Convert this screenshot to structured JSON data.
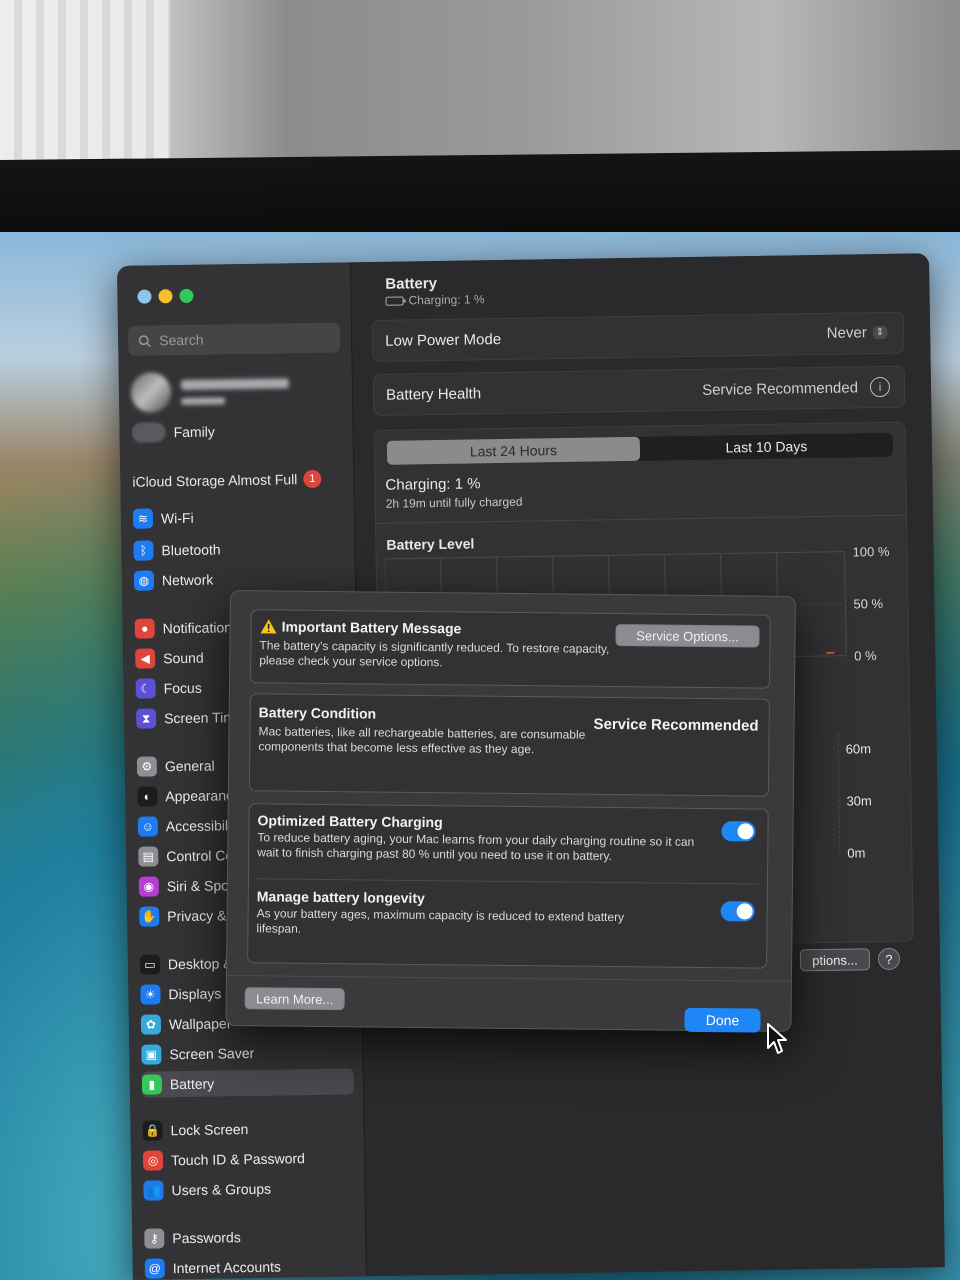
{
  "colors": {
    "accent": "#1f86f5",
    "badge": "#e0453b",
    "warning": "#f5c518"
  },
  "sidebar": {
    "search_placeholder": "Search",
    "family_label": "Family",
    "icloud_label": "iCloud Storage Almost Full",
    "icloud_badge": "1",
    "items": [
      {
        "label": "Wi-Fi",
        "icon": "wifi-icon",
        "color": "#1e7cf2"
      },
      {
        "label": "Bluetooth",
        "icon": "bluetooth-icon",
        "color": "#1e7cf2"
      },
      {
        "label": "Network",
        "icon": "globe-icon",
        "color": "#1e7cf2"
      },
      {
        "label": "Notification",
        "icon": "bell-icon",
        "color": "#e0453b"
      },
      {
        "label": "Sound",
        "icon": "speaker-icon",
        "color": "#e0453b"
      },
      {
        "label": "Focus",
        "icon": "moon-icon",
        "color": "#5b50d6"
      },
      {
        "label": "Screen Tim",
        "icon": "hourglass-icon",
        "color": "#5b50d6"
      },
      {
        "label": "General",
        "icon": "gear-icon",
        "color": "#8e8e93"
      },
      {
        "label": "Appearanc",
        "icon": "appearance-icon",
        "color": "#1c1c1e"
      },
      {
        "label": "Accessibili",
        "icon": "accessibility-icon",
        "color": "#1e7cf2"
      },
      {
        "label": "Control Ce",
        "icon": "control-center-icon",
        "color": "#8e8e93"
      },
      {
        "label": "Siri & Spot",
        "icon": "siri-icon",
        "color": "#b43fd1"
      },
      {
        "label": "Privacy & S",
        "icon": "hand-icon",
        "color": "#1e7cf2"
      },
      {
        "label": "Desktop &",
        "icon": "dock-icon",
        "color": "#1c1c1e"
      },
      {
        "label": "Displays",
        "icon": "sun-icon",
        "color": "#1e7cf2"
      },
      {
        "label": "Wallpaper",
        "icon": "flower-icon",
        "color": "#35aadc"
      },
      {
        "label": "Screen Saver",
        "icon": "screen-saver-icon",
        "color": "#35aadc"
      },
      {
        "label": "Battery",
        "icon": "battery-icon",
        "color": "#34c759"
      },
      {
        "label": "Lock Screen",
        "icon": "lock-icon",
        "color": "#1c1c1e"
      },
      {
        "label": "Touch ID & Password",
        "icon": "fingerprint-icon",
        "color": "#e0453b"
      },
      {
        "label": "Users & Groups",
        "icon": "users-icon",
        "color": "#1e7cf2"
      },
      {
        "label": "Passwords",
        "icon": "key-icon",
        "color": "#8e8e93"
      },
      {
        "label": "Internet Accounts",
        "icon": "at-icon",
        "color": "#1e7cf2"
      }
    ]
  },
  "main": {
    "title": "Battery",
    "subtitle": "Charging: 1 %",
    "low_power_label": "Low Power Mode",
    "low_power_value": "Never",
    "health_label": "Battery Health",
    "health_value": "Service Recommended",
    "tabs": [
      "Last 24 Hours",
      "Last 10 Days"
    ],
    "charging_status": "Charging: 1 %",
    "charging_time": "2h 19m until fully charged",
    "battery_level_heading": "Battery Level",
    "level_ticks": [
      "100 %",
      "50 %",
      "0 %"
    ],
    "usage_ticks": [
      "60m",
      "30m",
      "0m"
    ],
    "options_button": "ptions...",
    "help_button": "?"
  },
  "sheet": {
    "message_title": "Important Battery Message",
    "message_body": "The battery's capacity is significantly reduced. To restore capacity, please check your service options.",
    "service_options_button": "Service Options...",
    "condition_title": "Battery Condition",
    "condition_body": "Mac batteries, like all rechargeable batteries, are consumable components that become less effective as they age.",
    "condition_value": "Service Recommended",
    "optimized_title": "Optimized Battery Charging",
    "optimized_body": "To reduce battery aging, your Mac learns from your daily charging routine so it can wait to finish charging past 80 % until you need to use it on battery.",
    "optimized_on": true,
    "longevity_title": "Manage battery longevity",
    "longevity_body": "As your battery ages, maximum capacity is reduced to extend battery lifespan.",
    "longevity_on": true,
    "learn_more_button": "Learn More...",
    "done_button": "Done"
  }
}
